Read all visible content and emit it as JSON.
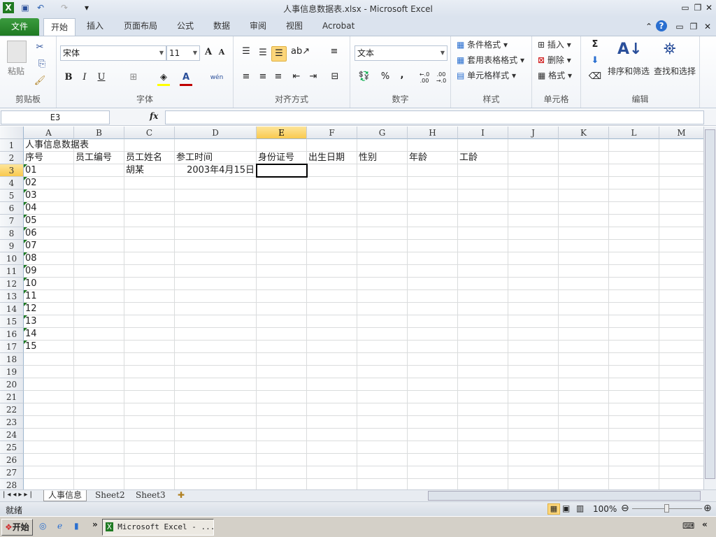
{
  "window": {
    "title": "人事信息数据表.xlsx  -  Microsoft Excel"
  },
  "quick_access": {
    "save_icon": "save-icon",
    "undo_icon": "undo-icon",
    "redo_icon": "redo-icon",
    "customize": "▾"
  },
  "tabs": [
    {
      "label": "文件"
    },
    {
      "label": "开始"
    },
    {
      "label": "插入"
    },
    {
      "label": "页面布局"
    },
    {
      "label": "公式"
    },
    {
      "label": "数据"
    },
    {
      "label": "审阅"
    },
    {
      "label": "视图"
    },
    {
      "label": "Acrobat"
    }
  ],
  "ribbon": {
    "clipboard": {
      "label": "剪贴板",
      "paste": "粘贴"
    },
    "font": {
      "label": "字体",
      "font_name": "宋体",
      "font_size": "11",
      "bold": "B",
      "italic": "I",
      "underline": "U",
      "grow": "A",
      "shrink": "A",
      "phonetic": "wén"
    },
    "alignment": {
      "label": "对齐方式"
    },
    "number": {
      "label": "数字",
      "format": "文本",
      "percent": "%",
      "comma": ",",
      "inc_decimal": "←.0 .00",
      "dec_decimal": ".00 →.0"
    },
    "styles": {
      "label": "样式",
      "conditional": "条件格式",
      "table": "套用表格格式",
      "cell_styles": "单元格样式"
    },
    "cells": {
      "label": "单元格",
      "insert": "插入",
      "delete": "删除",
      "format": "格式"
    },
    "editing": {
      "label": "编辑",
      "sum": "Σ",
      "sort": "排序和筛选",
      "find": "查找和选择"
    }
  },
  "formula_bar": {
    "name_box": "E3",
    "fx": "fx",
    "value": ""
  },
  "columns": [
    "A",
    "B",
    "C",
    "D",
    "E",
    "F",
    "G",
    "H",
    "I",
    "J",
    "K",
    "L",
    "M"
  ],
  "rows": [
    "1",
    "2",
    "3",
    "4",
    "5",
    "6",
    "7",
    "8",
    "9",
    "10",
    "11",
    "12",
    "13",
    "14",
    "15",
    "16",
    "17",
    "18",
    "19",
    "20",
    "21",
    "22",
    "23",
    "24",
    "25",
    "26",
    "27",
    "28"
  ],
  "selected_cell": "E3",
  "cells": {
    "A1": "人事信息数据表",
    "A2": "序号",
    "B2": "员工编号",
    "C2": "员工姓名",
    "D2": "参工时间",
    "E2": "身份证号",
    "F2": "出生日期",
    "G2": "性别",
    "H2": "年龄",
    "I2": "工龄",
    "A3": "01",
    "C3": "胡某",
    "D3": "2003年4月15日",
    "A4": "02",
    "A5": "03",
    "A6": "04",
    "A7": "05",
    "A8": "06",
    "A9": "07",
    "A10": "08",
    "A11": "09",
    "A12": "10",
    "A13": "11",
    "A14": "12",
    "A15": "13",
    "A16": "14",
    "A17": "15"
  },
  "sheets": [
    {
      "label": "人事信息"
    },
    {
      "label": "Sheet2"
    },
    {
      "label": "Sheet3"
    }
  ],
  "status": {
    "ready": "就绪",
    "zoom": "100%"
  },
  "taskbar": {
    "start": "开始",
    "window": "Microsoft Excel - ..."
  }
}
